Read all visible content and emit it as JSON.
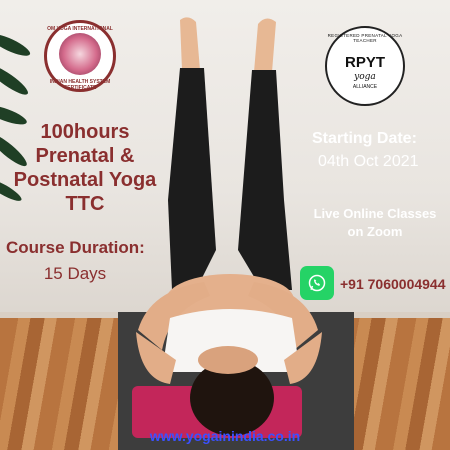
{
  "logo": {
    "top_text": "OM YOGA INTERNATIONAL",
    "bottom_text": "INDIAN HEALTH SYSTEM CERTIFICATE",
    "icon": "lotus-meditation-icon"
  },
  "course": {
    "title_lines": [
      "100hours",
      "Prenatal &",
      "Postnatal Yoga",
      "TTC"
    ],
    "duration_label": "Course Duration:",
    "duration_value": "15 Days"
  },
  "badge": {
    "ring_text": "REGISTERED PRENATAL YOGA TEACHER",
    "main": "RPYT",
    "sub": "yoga",
    "sub2": "ALLIANCE"
  },
  "schedule": {
    "start_label": "Starting Date:",
    "start_date": "04th Oct 2021",
    "mode_lines": [
      "Live Online Classes",
      "on Zoom"
    ]
  },
  "contact": {
    "phone": "+91 7060004944",
    "icon": "whatsapp-icon",
    "website": "www.yogainindia.co.in"
  },
  "colors": {
    "brand": "#8a2f2f",
    "whatsapp": "#25d366",
    "link": "#3a51ff"
  }
}
